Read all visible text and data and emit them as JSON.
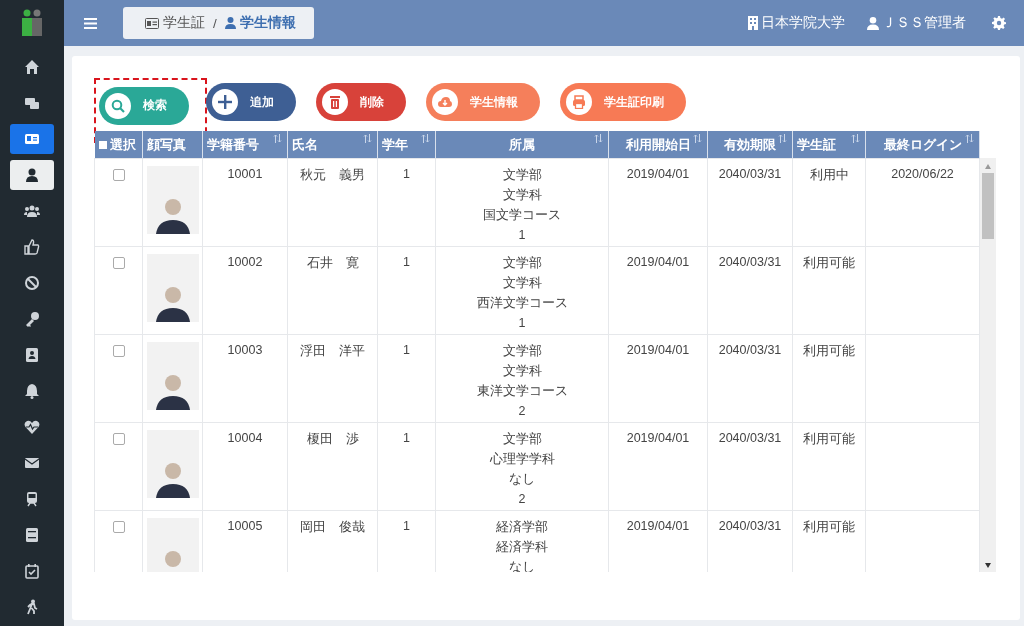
{
  "sidebar": {
    "items": [
      {
        "selected": false,
        "highlighted": false
      },
      {
        "selected": false,
        "highlighted": false
      },
      {
        "selected": true,
        "highlighted": false
      },
      {
        "selected": false,
        "highlighted": true
      },
      {
        "selected": false,
        "highlighted": false
      },
      {
        "selected": false,
        "highlighted": false
      },
      {
        "selected": false,
        "highlighted": false
      },
      {
        "selected": false,
        "highlighted": false
      },
      {
        "selected": false,
        "highlighted": false
      },
      {
        "selected": false,
        "highlighted": false
      },
      {
        "selected": false,
        "highlighted": false
      },
      {
        "selected": false,
        "highlighted": false
      },
      {
        "selected": false,
        "highlighted": false
      },
      {
        "selected": false,
        "highlighted": false
      },
      {
        "selected": false,
        "highlighted": false
      },
      {
        "selected": false,
        "highlighted": false
      }
    ]
  },
  "breadcrumb": {
    "items": [
      "学生証",
      "学生情報"
    ],
    "separator": "/"
  },
  "header": {
    "university": "日本学院大学",
    "user": "ＪＳＳ管理者"
  },
  "toolbar": {
    "buttons": [
      {
        "kind": "search",
        "label": "検索",
        "highlighted": true
      },
      {
        "kind": "add",
        "label": "追加",
        "highlighted": false
      },
      {
        "kind": "delete",
        "label": "削除",
        "highlighted": false
      },
      {
        "kind": "download",
        "label": "学生情報",
        "highlighted": false
      },
      {
        "kind": "print",
        "label": "学生証印刷",
        "highlighted": false
      }
    ]
  },
  "table": {
    "columns": [
      {
        "label": "選択",
        "sortable": false
      },
      {
        "label": "顔写真",
        "sortable": false
      },
      {
        "label": "学籍番号",
        "sortable": true
      },
      {
        "label": "氏名",
        "sortable": true
      },
      {
        "label": "学年",
        "sortable": true
      },
      {
        "label": "所属",
        "sortable": true
      },
      {
        "label": "利用開始日",
        "sortable": true
      },
      {
        "label": "有効期限",
        "sortable": true
      },
      {
        "label": "学生証",
        "sortable": true
      },
      {
        "label": "最終ログイン",
        "sortable": true
      }
    ],
    "rows": [
      {
        "checked": false,
        "id": "10001",
        "name": "秋元　義男",
        "grade": "1",
        "affiliation": [
          "文学部",
          "文学科",
          "国文学コース",
          "1"
        ],
        "start": "2019/04/01",
        "expiry": "2040/03/31",
        "card": "利用中",
        "last_login": "2020/06/22"
      },
      {
        "checked": false,
        "id": "10002",
        "name": "石井　寛",
        "grade": "1",
        "affiliation": [
          "文学部",
          "文学科",
          "西洋文学コース",
          "1"
        ],
        "start": "2019/04/01",
        "expiry": "2040/03/31",
        "card": "利用可能"
      },
      {
        "checked": false,
        "id": "10003",
        "name": "浮田　洋平",
        "grade": "1",
        "affiliation": [
          "文学部",
          "文学科",
          "東洋文学コース",
          "2"
        ],
        "start": "2019/04/01",
        "expiry": "2040/03/31",
        "card": "利用可能"
      },
      {
        "checked": false,
        "id": "10004",
        "name": "榎田　渉",
        "grade": "1",
        "affiliation": [
          "文学部",
          "心理学学科",
          "なし",
          "2"
        ],
        "start": "2019/04/01",
        "expiry": "2040/03/31",
        "card": "利用可能"
      },
      {
        "checked": false,
        "id": "10005",
        "name": "岡田　俊哉",
        "grade": "1",
        "affiliation": [
          "経済学部",
          "経済学科",
          "なし"
        ],
        "start": "2019/04/01",
        "expiry": "2040/03/31",
        "card": "利用可能"
      }
    ]
  }
}
